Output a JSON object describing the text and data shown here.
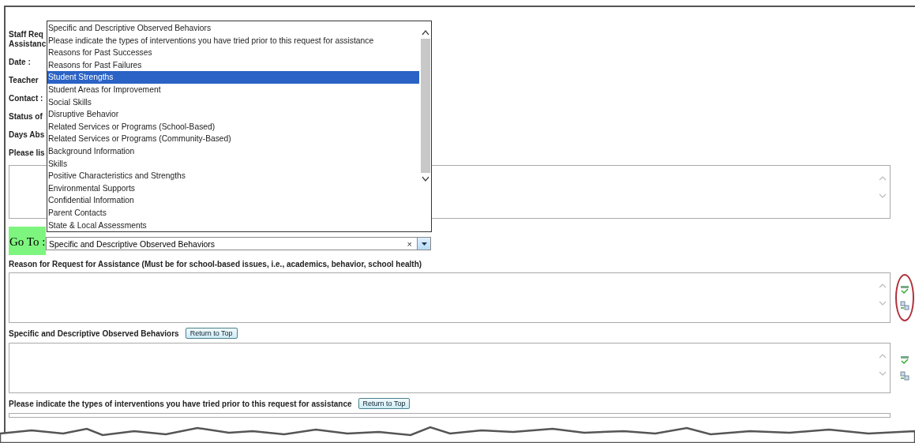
{
  "form_labels": [
    "Staff Req",
    "Assistanc",
    "Date :",
    "Teacher",
    "Contact :",
    "Status of",
    "Days Abs",
    "Please lis"
  ],
  "dropdown": {
    "items": [
      {
        "label": "Specific and Descriptive Observed Behaviors",
        "selected": false
      },
      {
        "label": "Please indicate the types of interventions you have tried prior to this request for assistance",
        "selected": false
      },
      {
        "label": "Reasons for Past Successes",
        "selected": false
      },
      {
        "label": "Reasons for Past Failures",
        "selected": false
      },
      {
        "label": "Student Strengths",
        "selected": true
      },
      {
        "label": "Student Areas for Improvement",
        "selected": false
      },
      {
        "label": "Social Skills",
        "selected": false
      },
      {
        "label": "Disruptive Behavior",
        "selected": false
      },
      {
        "label": "Related Services or Programs (School-Based)",
        "selected": false
      },
      {
        "label": "Related Services or Programs (Community-Based)",
        "selected": false
      },
      {
        "label": "Background Information",
        "selected": false
      },
      {
        "label": "Skills",
        "selected": false
      },
      {
        "label": "Positive Characteristics and Strengths",
        "selected": false
      },
      {
        "label": "Environmental Supports",
        "selected": false
      },
      {
        "label": "Confidential Information",
        "selected": false
      },
      {
        "label": "Parent Contacts",
        "selected": false
      },
      {
        "label": "State & Local Assessments",
        "selected": false
      }
    ]
  },
  "go_to": {
    "label": "Go To :",
    "value": "Specific and Descriptive Observed Behaviors",
    "clear": "×"
  },
  "sections": [
    {
      "label": "Reason for Request for Assistance (Must be for school-based issues, i.e., academics, behavior, school health)",
      "highlighted": true
    },
    {
      "label": "Specific and Descriptive Observed Behaviors",
      "return_button": "Return to Top",
      "highlighted": false
    },
    {
      "label": "Please indicate the types of interventions you have tried prior to this request for assistance",
      "return_button": "Return to Top"
    }
  ]
}
